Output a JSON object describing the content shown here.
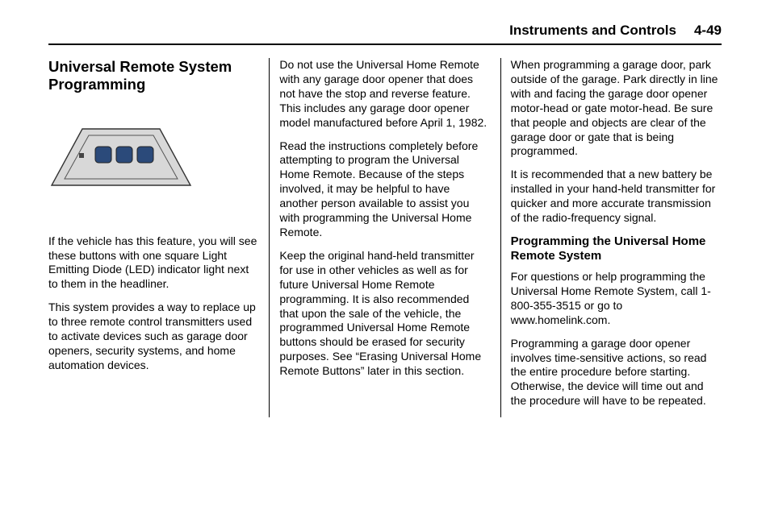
{
  "header": {
    "chapter": "Instruments and Controls",
    "page": "4-49"
  },
  "col1": {
    "title": "Universal Remote System Programming",
    "p1": "If the vehicle has this feature, you will see these buttons with one square Light Emitting Diode (LED) indicator light next to them in the headliner.",
    "p2": "This system provides a way to replace up to three remote control transmitters used to activate devices such as garage door openers, security systems, and home automation devices."
  },
  "col2": {
    "p1": "Do not use the Universal Home Remote with any garage door opener that does not have the stop and reverse feature. This includes any garage door opener model manufactured before April 1, 1982.",
    "p2": "Read the instructions completely before attempting to program the Universal Home Remote. Because of the steps involved, it may be helpful to have another person available to assist you with programming the Universal Home Remote.",
    "p3": "Keep the original hand-held transmitter for use in other vehicles as well as for future Universal Home Remote programming. It is also recommended that upon the sale of the vehicle, the programmed Universal Home Remote buttons should be erased for security purposes. See “Erasing Universal Home Remote Buttons” later in this section."
  },
  "col3": {
    "p1": "When programming a garage door, park outside of the garage. Park directly in line with and facing the garage door opener motor-head or gate motor-head. Be sure that people and objects are clear of the garage door or gate that is being programmed.",
    "p2": "It is recommended that a new battery be installed in your hand-held transmitter for quicker and more accurate transmission of the radio-frequency signal.",
    "sub": "Programming the Universal Home Remote System",
    "p3": "For questions or help programming the Universal Home Remote System, call 1-800-355-3515 or go to www.homelink.com.",
    "p4": "Programming a garage door opener involves time-sensitive actions, so read the entire procedure before starting. Otherwise, the device will time out and the procedure will have to be repeated."
  }
}
